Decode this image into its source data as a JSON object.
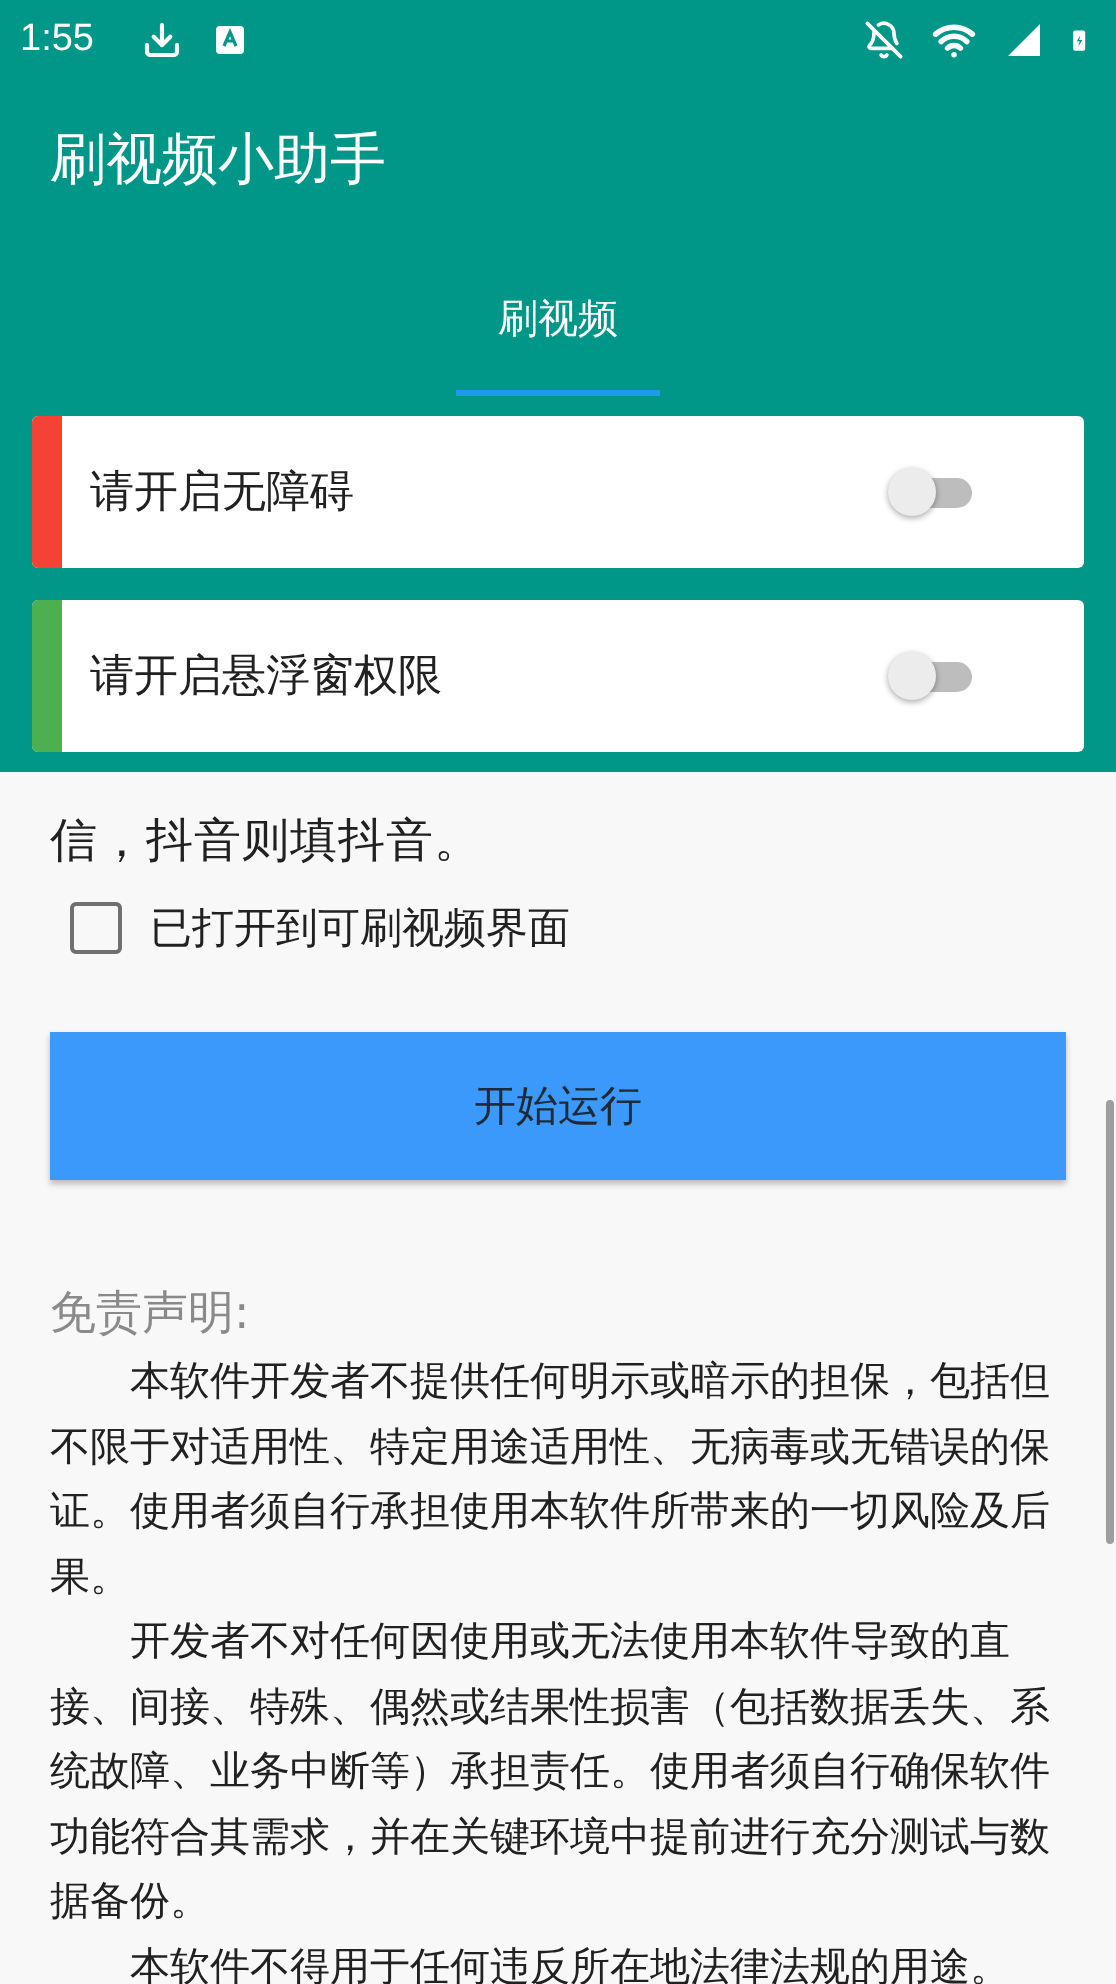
{
  "status_bar": {
    "time": "1:55"
  },
  "app_bar": {
    "title": "刷视频小助手"
  },
  "tabs": [
    {
      "label": "刷视频",
      "selected": true
    }
  ],
  "permissions": [
    {
      "label": "请开启无障碍",
      "on": false,
      "color": "#f44336"
    },
    {
      "label": "请开启悬浮窗权限",
      "on": false,
      "color": "#4caf50"
    }
  ],
  "hint": "信，抖音则填抖音。",
  "checkbox": {
    "label": "已打开到可刷视频界面",
    "checked": false
  },
  "start_button": "开始运行",
  "disclaimer": {
    "title": "免责声明:",
    "paragraphs": [
      "本软件开发者不提供任何明示或暗示的担保，包括但不限于对适用性、特定用途适用性、无病毒或无错误的保证。使用者须自行承担使用本软件所带来的一切风险及后果。",
      "开发者不对任何因使用或无法使用本软件导致的直接、间接、特殊、偶然或结果性损害（包括数据丢失、系统故障、业务中断等）承担责任。使用者须自行确保软件功能符合其需求，并在关键环境中提前进行充分测试与数据备份。",
      "本软件不得用于任何违反所在地法律法规的用途。"
    ]
  }
}
